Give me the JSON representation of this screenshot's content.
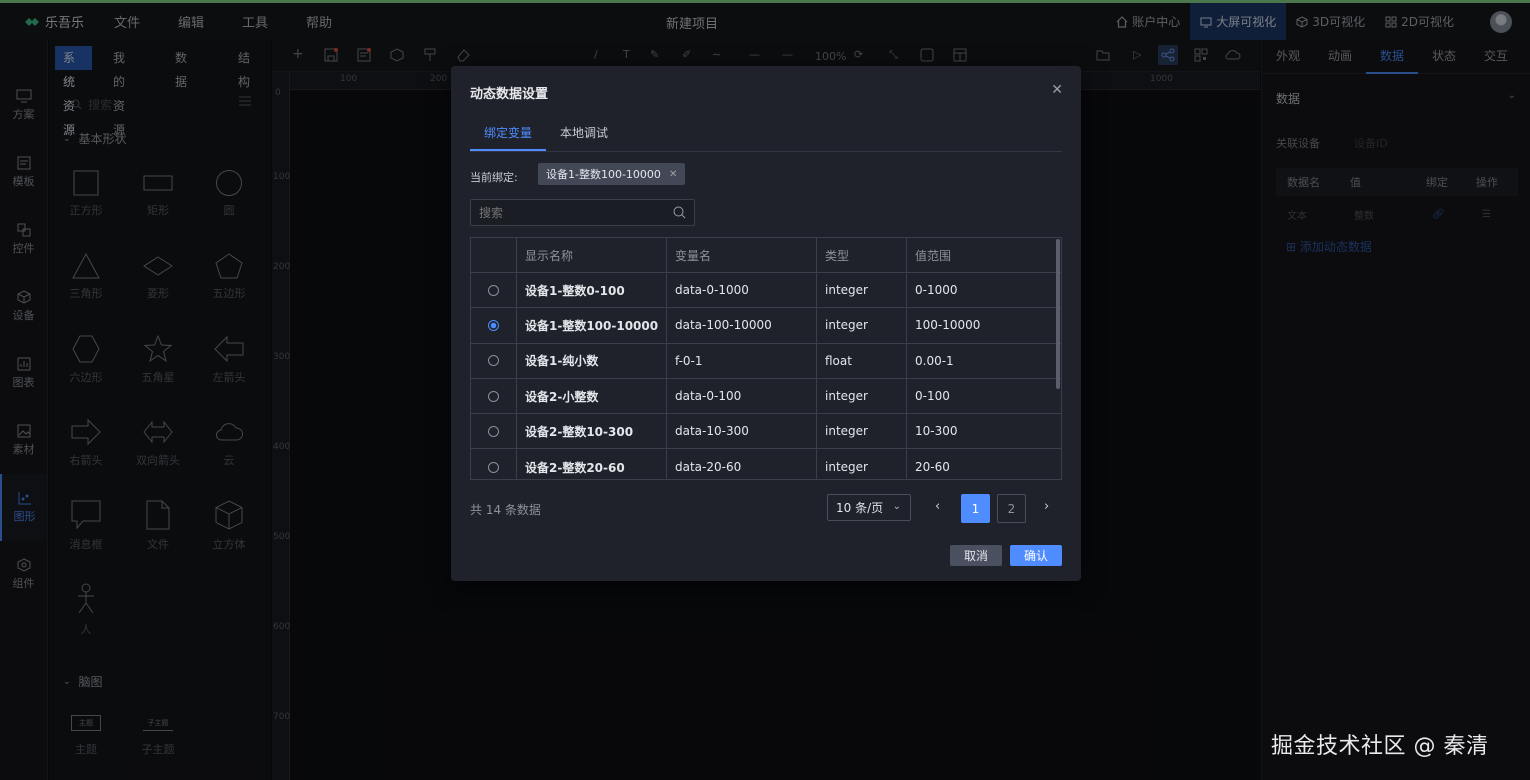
{
  "topbar": {
    "brand": "乐吾乐",
    "menus": [
      "文件",
      "编辑",
      "工具",
      "帮助"
    ],
    "project_title": "新建项目",
    "right_items": [
      {
        "label": "账户中心",
        "active": false
      },
      {
        "label": "大屏可视化",
        "active": true
      },
      {
        "label": "3D可视化",
        "active": false
      },
      {
        "label": "2D可视化",
        "active": false
      }
    ]
  },
  "left_nav": [
    "方案",
    "模板",
    "控件",
    "设备",
    "图表",
    "素材",
    "图形",
    "组件"
  ],
  "resource_tabs": [
    "系统资源",
    "我的资源",
    "数据",
    "结构"
  ],
  "resource_panel": {
    "search_placeholder": "搜索",
    "group_basic": "基本形状",
    "shapes": [
      "正方形",
      "矩形",
      "圆",
      "三角形",
      "菱形",
      "五边形",
      "六边形",
      "五角星",
      "左箭头",
      "右箭头",
      "双向箭头",
      "云",
      "消息框",
      "文件",
      "立方体",
      "人"
    ],
    "group_mindmap": "脑图",
    "mindmap_items": [
      "主题",
      "子主题"
    ],
    "mindmap_box_labels": [
      "主题",
      "子主题"
    ]
  },
  "toolbar": {
    "zoom": "100%"
  },
  "ruler": {
    "top_labels": [
      "100",
      "200",
      "1000"
    ],
    "left_labels": [
      "0",
      "100",
      "200",
      "300",
      "400",
      "500",
      "600",
      "700"
    ]
  },
  "right_panel": {
    "tabs": [
      "外观",
      "动画",
      "数据",
      "状态",
      "交互"
    ],
    "active_tab": "数据",
    "section_title": "数据",
    "device_label": "关联设备",
    "device_placeholder": "设备ID",
    "table_headers": [
      "数据名",
      "值",
      "绑定",
      "操作"
    ],
    "row": {
      "name": "文本",
      "value": "整数"
    },
    "add_label": "添加动态数据"
  },
  "watermark": "掘金技术社区 @ 秦清",
  "modal": {
    "title": "动态数据设置",
    "tabs": [
      "绑定变量",
      "本地调试"
    ],
    "current_label": "当前绑定:",
    "current_binding": "设备1-整数100-10000",
    "search_placeholder": "搜索",
    "columns": [
      "显示名称",
      "变量名",
      "类型",
      "值范围"
    ],
    "rows": [
      {
        "selected": false,
        "name": "设备1-整数0-100",
        "var": "data-0-1000",
        "type": "integer",
        "range": "0-1000"
      },
      {
        "selected": true,
        "name": "设备1-整数100-10000",
        "var": "data-100-10000",
        "type": "integer",
        "range": "100-10000"
      },
      {
        "selected": false,
        "name": "设备1-纯小数",
        "var": "f-0-1",
        "type": "float",
        "range": "0.00-1"
      },
      {
        "selected": false,
        "name": "设备2-小整数",
        "var": "data-0-100",
        "type": "integer",
        "range": "0-100"
      },
      {
        "selected": false,
        "name": "设备2-整数10-300",
        "var": "data-10-300",
        "type": "integer",
        "range": "10-300"
      },
      {
        "selected": false,
        "name": "设备2-整数20-60",
        "var": "data-20-60",
        "type": "integer",
        "range": "20-60"
      }
    ],
    "total": "共 14 条数据",
    "page_size": "10 条/页",
    "pages": [
      "1",
      "2"
    ],
    "current_page": "1",
    "cancel": "取消",
    "confirm": "确认"
  },
  "colors": {
    "accent": "#4e8cff",
    "brand_green": "#8ad88a",
    "panel_bg": "#16171c",
    "modal_bg": "#1f222a"
  }
}
